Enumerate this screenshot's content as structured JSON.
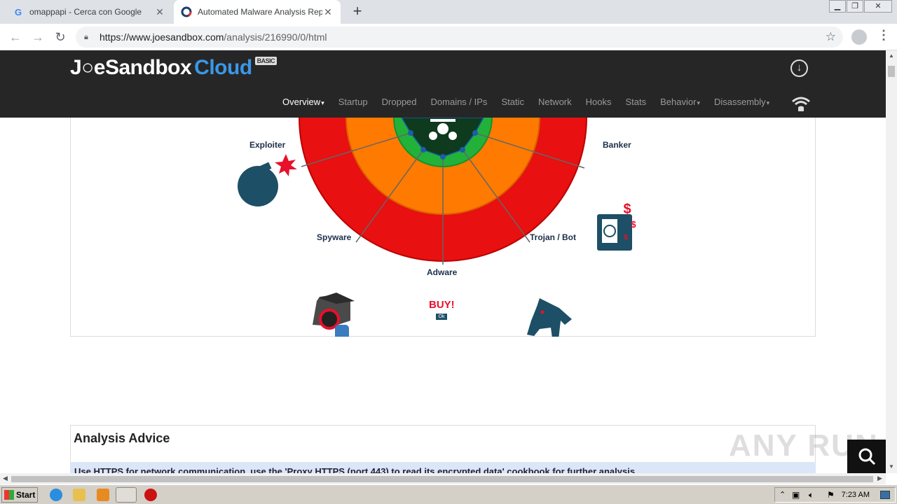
{
  "browser": {
    "tabs": [
      {
        "title": "omappapi - Cerca con Google",
        "favicon": "G",
        "active": false
      },
      {
        "title": "Automated Malware Analysis Report",
        "active": true
      }
    ],
    "url_host": "https://www.joesandbox.com",
    "url_path": "/analysis/216990/0/html"
  },
  "site": {
    "logo_text": "J○eSandbox",
    "logo_cloud": "Cloud",
    "logo_badge": "BASIC",
    "nav": [
      {
        "label": "Overview",
        "caret": true,
        "active": true
      },
      {
        "label": "Startup",
        "caret": false
      },
      {
        "label": "Dropped",
        "caret": false
      },
      {
        "label": "Domains / IPs",
        "caret": false
      },
      {
        "label": "Static",
        "caret": false
      },
      {
        "label": "Network",
        "caret": false
      },
      {
        "label": "Hooks",
        "caret": false
      },
      {
        "label": "Stats",
        "caret": false
      },
      {
        "label": "Behavior",
        "caret": true
      },
      {
        "label": "Disassembly",
        "caret": true
      }
    ]
  },
  "diagram": {
    "categories": {
      "exploiter": "Exploiter",
      "banker": "Banker",
      "spyware": "Spyware",
      "trojan": "Trojan / Bot",
      "adware": "Adware"
    },
    "adware_buy": "BUY!",
    "adware_ok": "Ok",
    "colors": {
      "outer": "#e81010",
      "middle": "#ff7a00",
      "inner": "#22b23a",
      "core": "#0e3a1e"
    }
  },
  "advice": {
    "title": "Analysis Advice",
    "text": "Use HTTPS for network communication, use the 'Proxy HTTPS (port 443) to read its encrypted data' cookbook for further analysis"
  },
  "watermark": "ANY RUN",
  "taskbar": {
    "start": "Start",
    "clock": "7:23 AM"
  }
}
